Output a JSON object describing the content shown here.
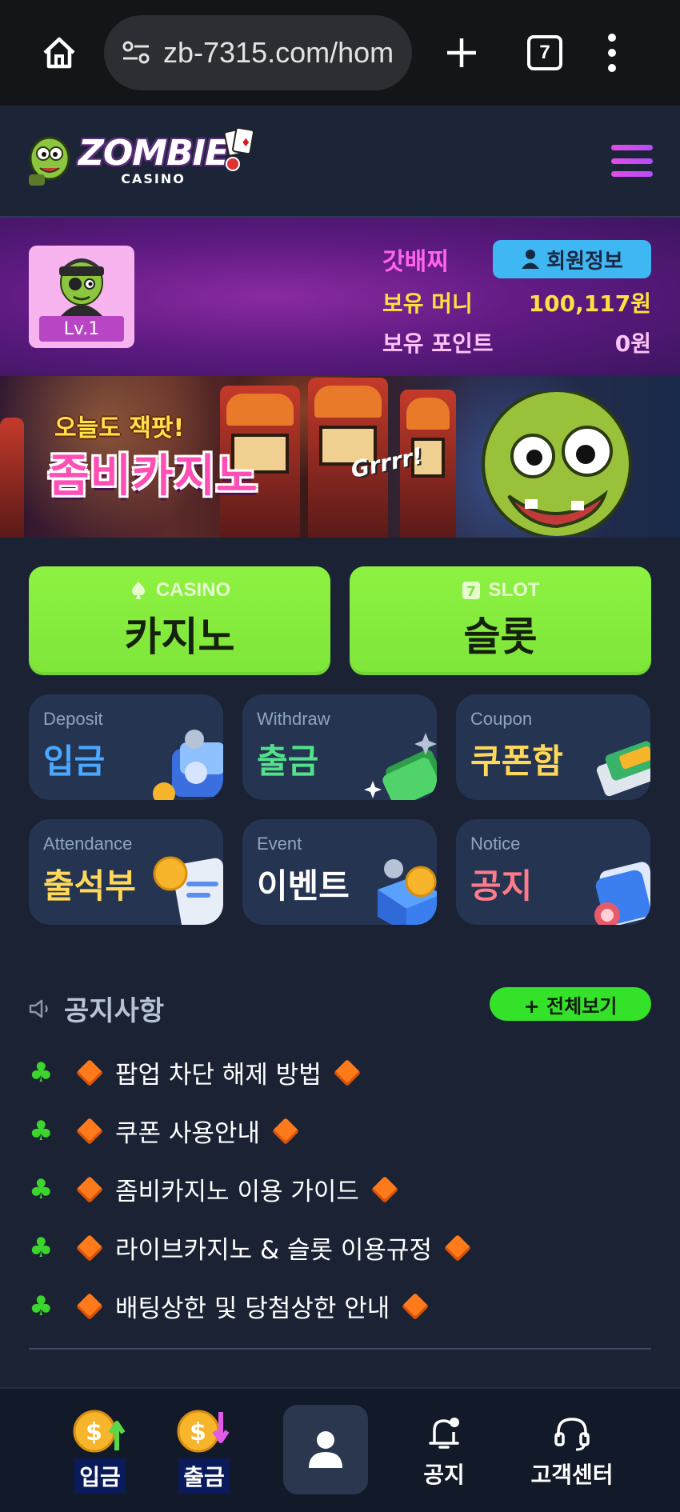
{
  "browser": {
    "url": "zb-7315.com/hom",
    "tab_count": "7"
  },
  "header": {
    "logo_top": "ZOMBIE",
    "logo_bottom": "CASINO"
  },
  "user": {
    "level": "Lv.1",
    "name": "갓배찌",
    "member_button": "회원정보",
    "money_label": "보유 머니",
    "money_value": "100,117원",
    "point_label": "보유 포인트",
    "point_value": "0원"
  },
  "banner": {
    "subtitle": "오늘도 잭팟!",
    "title": "좀비카지노",
    "sound": "Grrrr!"
  },
  "games": [
    {
      "en": "CASINO",
      "ko": "카지노",
      "icon": "spade-icon"
    },
    {
      "en": "SLOT",
      "ko": "슬롯",
      "icon": "slot-seven-icon"
    }
  ],
  "menu": [
    {
      "en": "Deposit",
      "ko": "입금",
      "color": "#4aa8ff"
    },
    {
      "en": "Withdraw",
      "ko": "출금",
      "color": "#52e08a"
    },
    {
      "en": "Coupon",
      "ko": "쿠폰함",
      "color": "#ffd85a"
    },
    {
      "en": "Attendance",
      "ko": "출석부",
      "color": "#ffd85a"
    },
    {
      "en": "Event",
      "ko": "이벤트",
      "color": "#ffffff"
    },
    {
      "en": "Notice",
      "ko": "공지",
      "color": "#ff7a8a"
    }
  ],
  "notice": {
    "title": "공지사항",
    "view_all": "+ 전체보기",
    "items": [
      "팝업 차단 해제 방법",
      "쿠폰 사용안내",
      "좀비카지노 이용 가이드",
      "라이브카지노 & 슬롯 이용규정",
      "배팅상한 및 당첨상한 안내"
    ]
  },
  "bottom_nav": {
    "deposit": "입금",
    "withdraw": "출금",
    "notice": "공지",
    "support": "고객센터"
  }
}
